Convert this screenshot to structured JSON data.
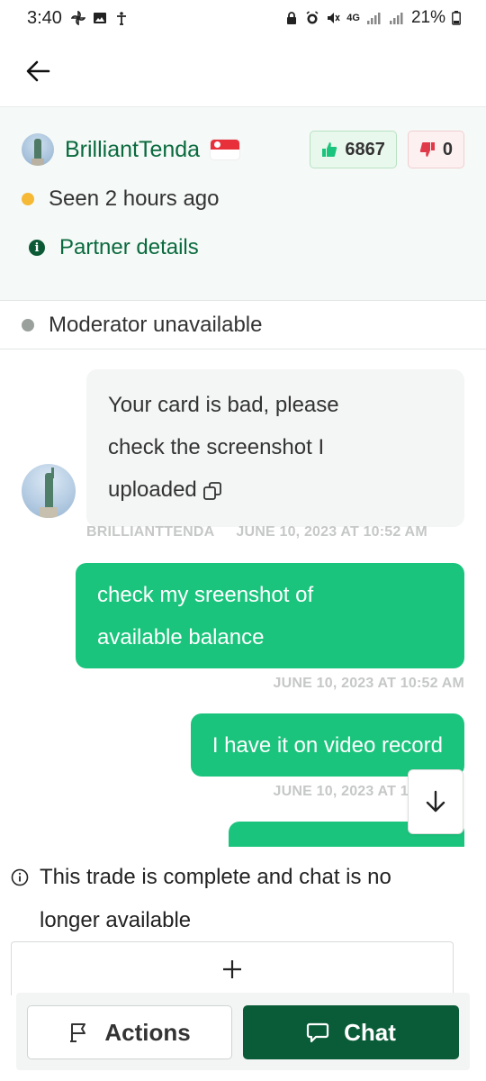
{
  "status_bar": {
    "time": "3:40",
    "network": "4G",
    "battery": "21%"
  },
  "partner": {
    "name": "BrilliantTenda",
    "country_flag": "singapore-flag",
    "thumbs_up_count": "6867",
    "thumbs_down_count": "0",
    "seen_status": "Seen 2 hours ago",
    "details_link": "Partner details"
  },
  "moderator": {
    "status": "Moderator unavailable"
  },
  "messages": [
    {
      "direction": "incoming",
      "text": "Your card is bad, please check the screenshot I uploaded",
      "line1": "Your card is bad, please",
      "line2": "check the screenshot I",
      "line3": "uploaded",
      "sender": "BRILLIANTTENDA",
      "timestamp": "JUNE 10, 2023 AT 10:52 AM"
    },
    {
      "direction": "outgoing",
      "line1": "check my sreenshot of",
      "line2": "available balance",
      "timestamp": "JUNE 10, 2023 AT 10:52 AM"
    },
    {
      "direction": "outgoing",
      "text": "I have it on video record",
      "timestamp": "JUNE 10, 2023 AT 10:52 AM"
    }
  ],
  "notice": {
    "text": "This trade is complete and chat is no longer available"
  },
  "bottom_bar": {
    "actions_label": "Actions",
    "chat_label": "Chat"
  },
  "colors": {
    "brand_green": "#0a6a3e",
    "outgoing_bubble": "#1bc47d",
    "chat_button": "#0a5c38",
    "online_dot": "#f5b935"
  }
}
